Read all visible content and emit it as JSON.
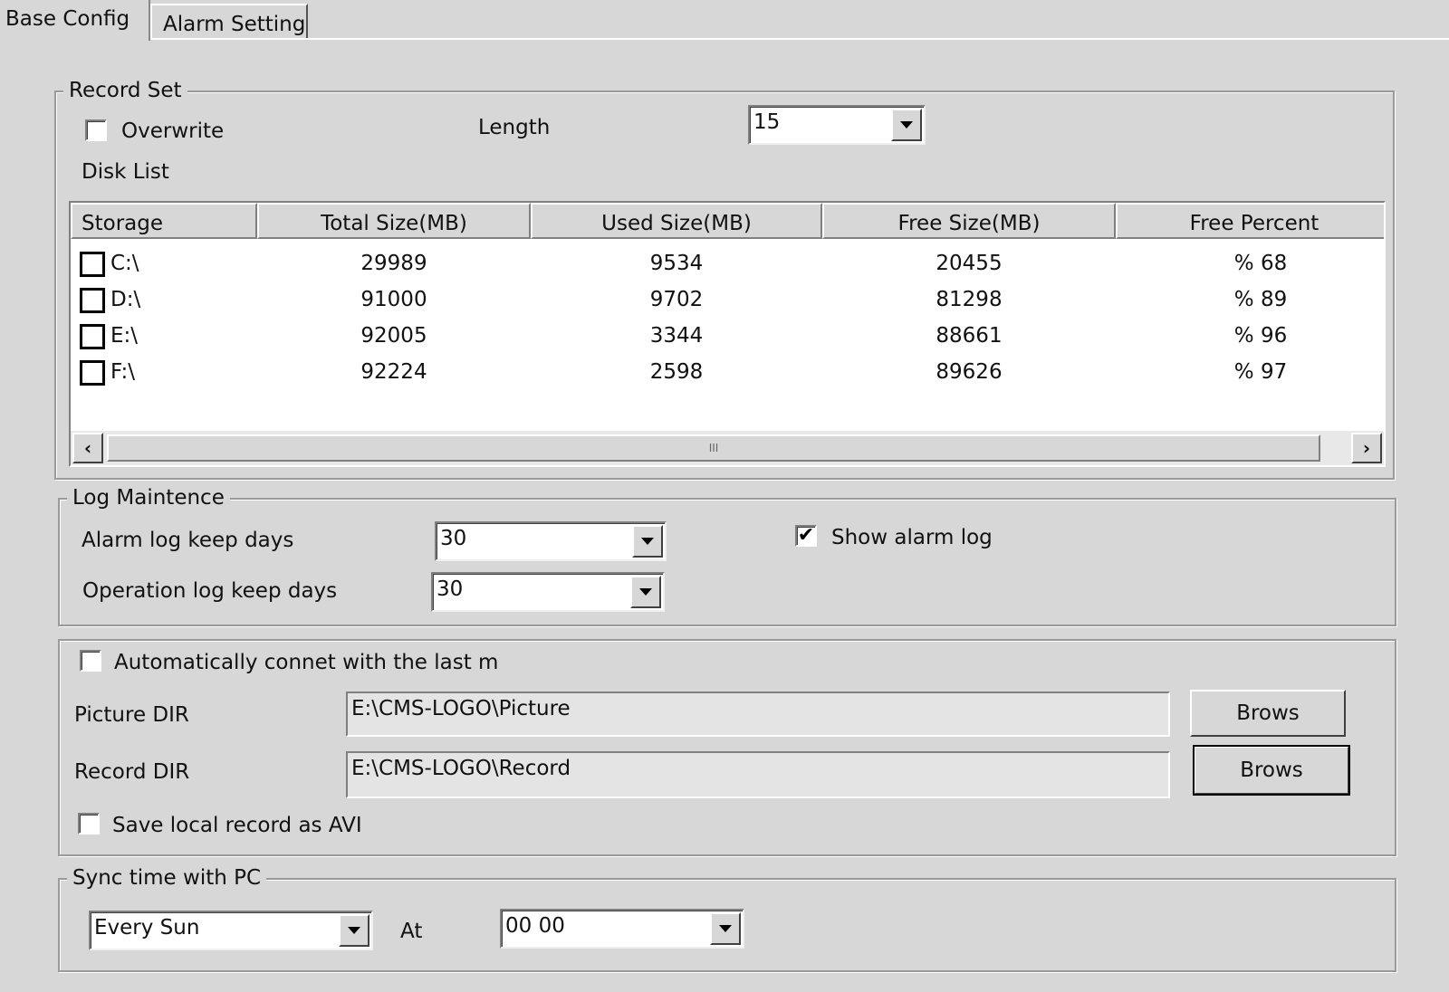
{
  "tabs": [
    {
      "label": "Base Config",
      "active": true
    },
    {
      "label": "Alarm Setting",
      "active": false
    }
  ],
  "record_set": {
    "legend": "Record Set",
    "overwrite_label": "Overwrite",
    "overwrite_checked": false,
    "length_label": "Length",
    "length_value": "15",
    "disk_list_label": "Disk List",
    "columns": [
      "Storage",
      "Total Size(MB)",
      "Used Size(MB)",
      "Free Size(MB)",
      "Free Percent"
    ],
    "rows": [
      {
        "storage": "C:\\",
        "total": "29989",
        "used": "9534",
        "free": "20455",
        "percent": "% 68",
        "checked": false
      },
      {
        "storage": "D:\\",
        "total": "91000",
        "used": "9702",
        "free": "81298",
        "percent": "% 89",
        "checked": false
      },
      {
        "storage": "E:\\",
        "total": "92005",
        "used": "3344",
        "free": "88661",
        "percent": "% 96",
        "checked": false
      },
      {
        "storage": "F:\\",
        "total": "92224",
        "used": "2598",
        "free": "89626",
        "percent": "% 97",
        "checked": false
      }
    ],
    "scroll_thumb_glyph": "III"
  },
  "log_maintence": {
    "legend": "Log Maintence",
    "alarm_label": "Alarm log keep days",
    "alarm_value": "30",
    "operation_label": "Operation log keep days",
    "operation_value": "30",
    "show_alarm_label": "Show alarm log",
    "show_alarm_checked": true
  },
  "directories": {
    "auto_connect_label": "Automatically connet with the last m",
    "auto_connect_checked": false,
    "picture_label": "Picture DIR",
    "picture_value": "E:\\CMS-LOGO\\Picture",
    "picture_button": "Brows",
    "record_label": "Record DIR",
    "record_value": "E:\\CMS-LOGO\\Record",
    "record_button": "Brows",
    "save_avi_label": "Save local record as AVI",
    "save_avi_checked": false
  },
  "sync_time": {
    "legend": "Sync time with PC",
    "frequency_value": "Every Sun",
    "at_label": "At",
    "time_value": "00 00"
  },
  "icons": {
    "check": "✔",
    "scroll_left": "‹",
    "scroll_right": "›"
  }
}
